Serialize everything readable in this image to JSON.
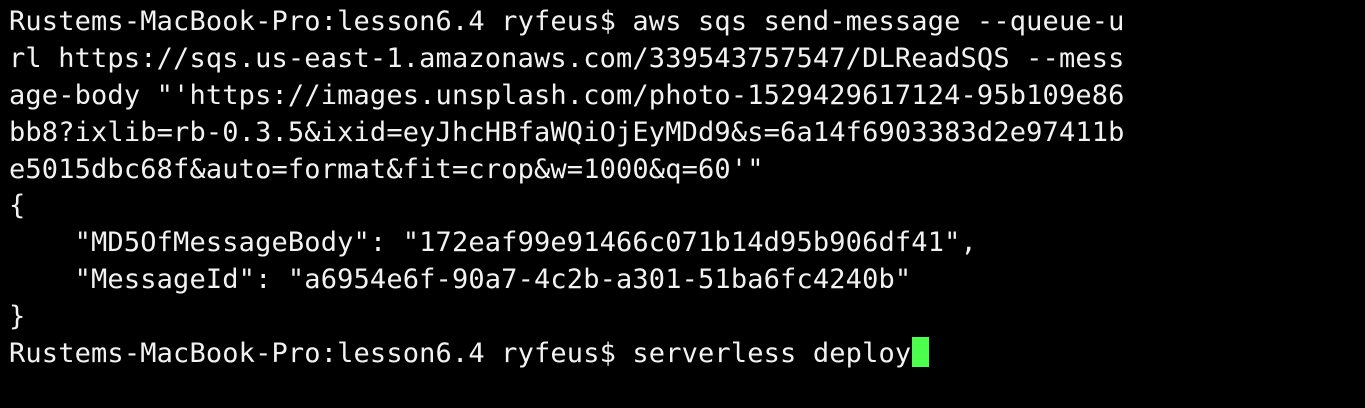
{
  "terminal": {
    "lines": [
      "Rustems-MacBook-Pro:lesson6.4 ryfeus$ aws sqs send-message --queue-u",
      "rl https://sqs.us-east-1.amazonaws.com/339543757547/DLReadSQS --mess",
      "age-body \"'https://images.unsplash.com/photo-1529429617124-95b109e86",
      "bb8?ixlib=rb-0.3.5&ixid=eyJhcHBfaWQiOjEyMDd9&s=6a14f6903383d2e97411b",
      "e5015dbc68f&auto=format&fit=crop&w=1000&q=60'\"",
      "{",
      "    \"MD5OfMessageBody\": \"172eaf99e91466c071b14d95b906df41\",",
      "    \"MessageId\": \"a6954e6f-90a7-4c2b-a301-51ba6fc4240b\"",
      "}"
    ],
    "prompt": "Rustems-MacBook-Pro:lesson6.4 ryfeus$ ",
    "current_command": "serverless deploy",
    "colors": {
      "background": "#000000",
      "text": "#f2f2f2",
      "cursor": "#4cff4c"
    }
  }
}
